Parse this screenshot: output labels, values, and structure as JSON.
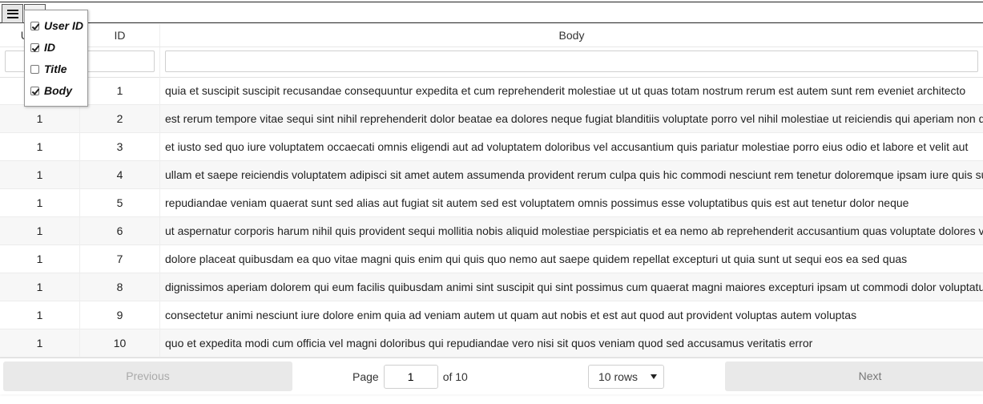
{
  "columns": {
    "user_id": "User ID",
    "id": "ID",
    "body": "Body"
  },
  "filters": {
    "user_id": "",
    "id": "",
    "body": ""
  },
  "column_menu": [
    {
      "label": "User ID",
      "checked": true
    },
    {
      "label": "ID",
      "checked": true
    },
    {
      "label": "Title",
      "checked": false
    },
    {
      "label": "Body",
      "checked": true
    }
  ],
  "rows": [
    {
      "user_id": "1",
      "id": "1",
      "body": "quia et suscipit suscipit recusandae consequuntur expedita et cum reprehenderit molestiae ut ut quas totam nostrum rerum est autem sunt rem eveniet architecto"
    },
    {
      "user_id": "1",
      "id": "2",
      "body": "est rerum tempore vitae sequi sint nihil reprehenderit dolor beatae ea dolores neque fugiat blanditiis voluptate porro vel nihil molestiae ut reiciendis qui aperiam non debitis possimus qui neque nisi nulla"
    },
    {
      "user_id": "1",
      "id": "3",
      "body": "et iusto sed quo iure voluptatem occaecati omnis eligendi aut ad voluptatem doloribus vel accusantium quis pariatur molestiae porro eius odio et labore et velit aut"
    },
    {
      "user_id": "1",
      "id": "4",
      "body": "ullam et saepe reiciendis voluptatem adipisci sit amet autem assumenda provident rerum culpa quis hic commodi nesciunt rem tenetur doloremque ipsam iure quis sunt voluptatem rerum illo velit"
    },
    {
      "user_id": "1",
      "id": "5",
      "body": "repudiandae veniam quaerat sunt sed alias aut fugiat sit autem sed est voluptatem omnis possimus esse voluptatibus quis est aut tenetur dolor neque"
    },
    {
      "user_id": "1",
      "id": "6",
      "body": "ut aspernatur corporis harum nihil quis provident sequi mollitia nobis aliquid molestiae perspiciatis et ea nemo ab reprehenderit accusantium quas voluptate dolores velit et doloremque molestiae"
    },
    {
      "user_id": "1",
      "id": "7",
      "body": "dolore placeat quibusdam ea quo vitae magni quis enim qui quis quo nemo aut saepe quidem repellat excepturi ut quia sunt ut sequi eos ea sed quas"
    },
    {
      "user_id": "1",
      "id": "8",
      "body": "dignissimos aperiam dolorem qui eum facilis quibusdam animi sint suscipit qui sint possimus cum quaerat magni maiores excepturi ipsam ut commodi dolor voluptatum modi aut vitae"
    },
    {
      "user_id": "1",
      "id": "9",
      "body": "consectetur animi nesciunt iure dolore enim quia ad veniam autem ut quam aut nobis et est aut quod aut provident voluptas autem voluptas"
    },
    {
      "user_id": "1",
      "id": "10",
      "body": "quo et expedita modi cum officia vel magni doloribus qui repudiandae vero nisi sit quos veniam quod sed accusamus veritatis error"
    }
  ],
  "pagination": {
    "previous_label": "Previous",
    "next_label": "Next",
    "page_label": "Page",
    "current_page": "1",
    "of_label": "of 10",
    "page_size": "10 rows"
  }
}
